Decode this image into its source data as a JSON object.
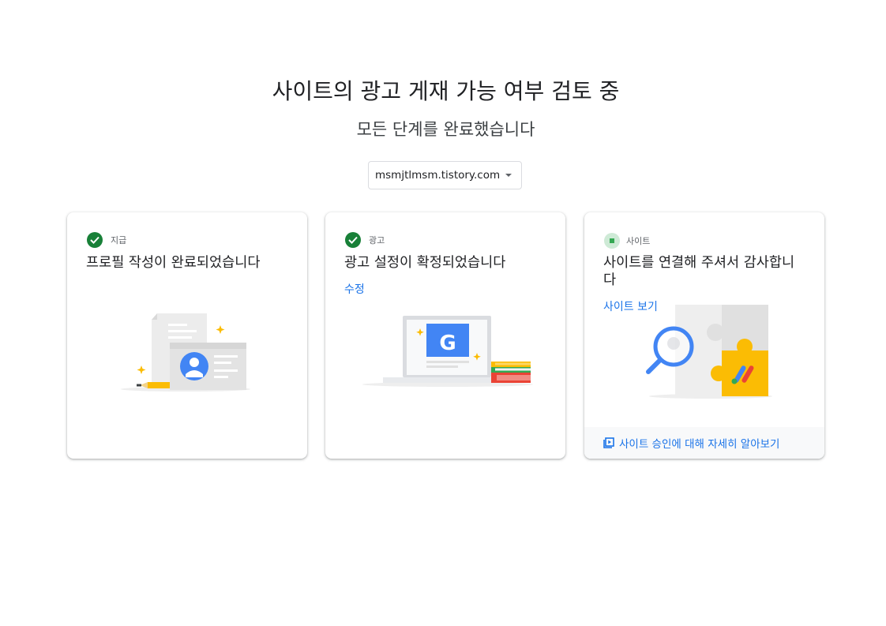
{
  "page": {
    "title": "사이트의 광고 게재 가능 여부 검토 중",
    "subtitle": "모든 단계를 완료했습니다"
  },
  "site_selector": {
    "value": "msmjtlmsm.tistory.com",
    "icon": "dropdown-arrow-icon"
  },
  "cards": [
    {
      "status_label": "지급",
      "status_icon": "check-circle-icon",
      "heading": "프로필 작성이 완료되었습니다",
      "illustration": "profile-card-illustration"
    },
    {
      "status_label": "광고",
      "status_icon": "check-circle-icon",
      "heading": "광고 설정이 확정되었습니다",
      "link": "수정",
      "illustration": "ads-laptop-illustration"
    },
    {
      "status_label": "사이트",
      "status_icon": "in-progress-square-icon",
      "heading": "사이트를 연결해 주셔서 감사합니다",
      "link": "사이트 보기",
      "footer_link": "사이트 승인에 대해 자세히 알아보기",
      "footer_icon": "video-play-icon",
      "illustration": "site-puzzle-illustration"
    }
  ],
  "colors": {
    "accent": "#1a73e8",
    "success": "#188038",
    "pending_bg": "#ceead6",
    "google_blue": "#4285f4",
    "google_yellow": "#fbbc04",
    "google_red": "#ea4335",
    "google_green": "#34a853"
  }
}
